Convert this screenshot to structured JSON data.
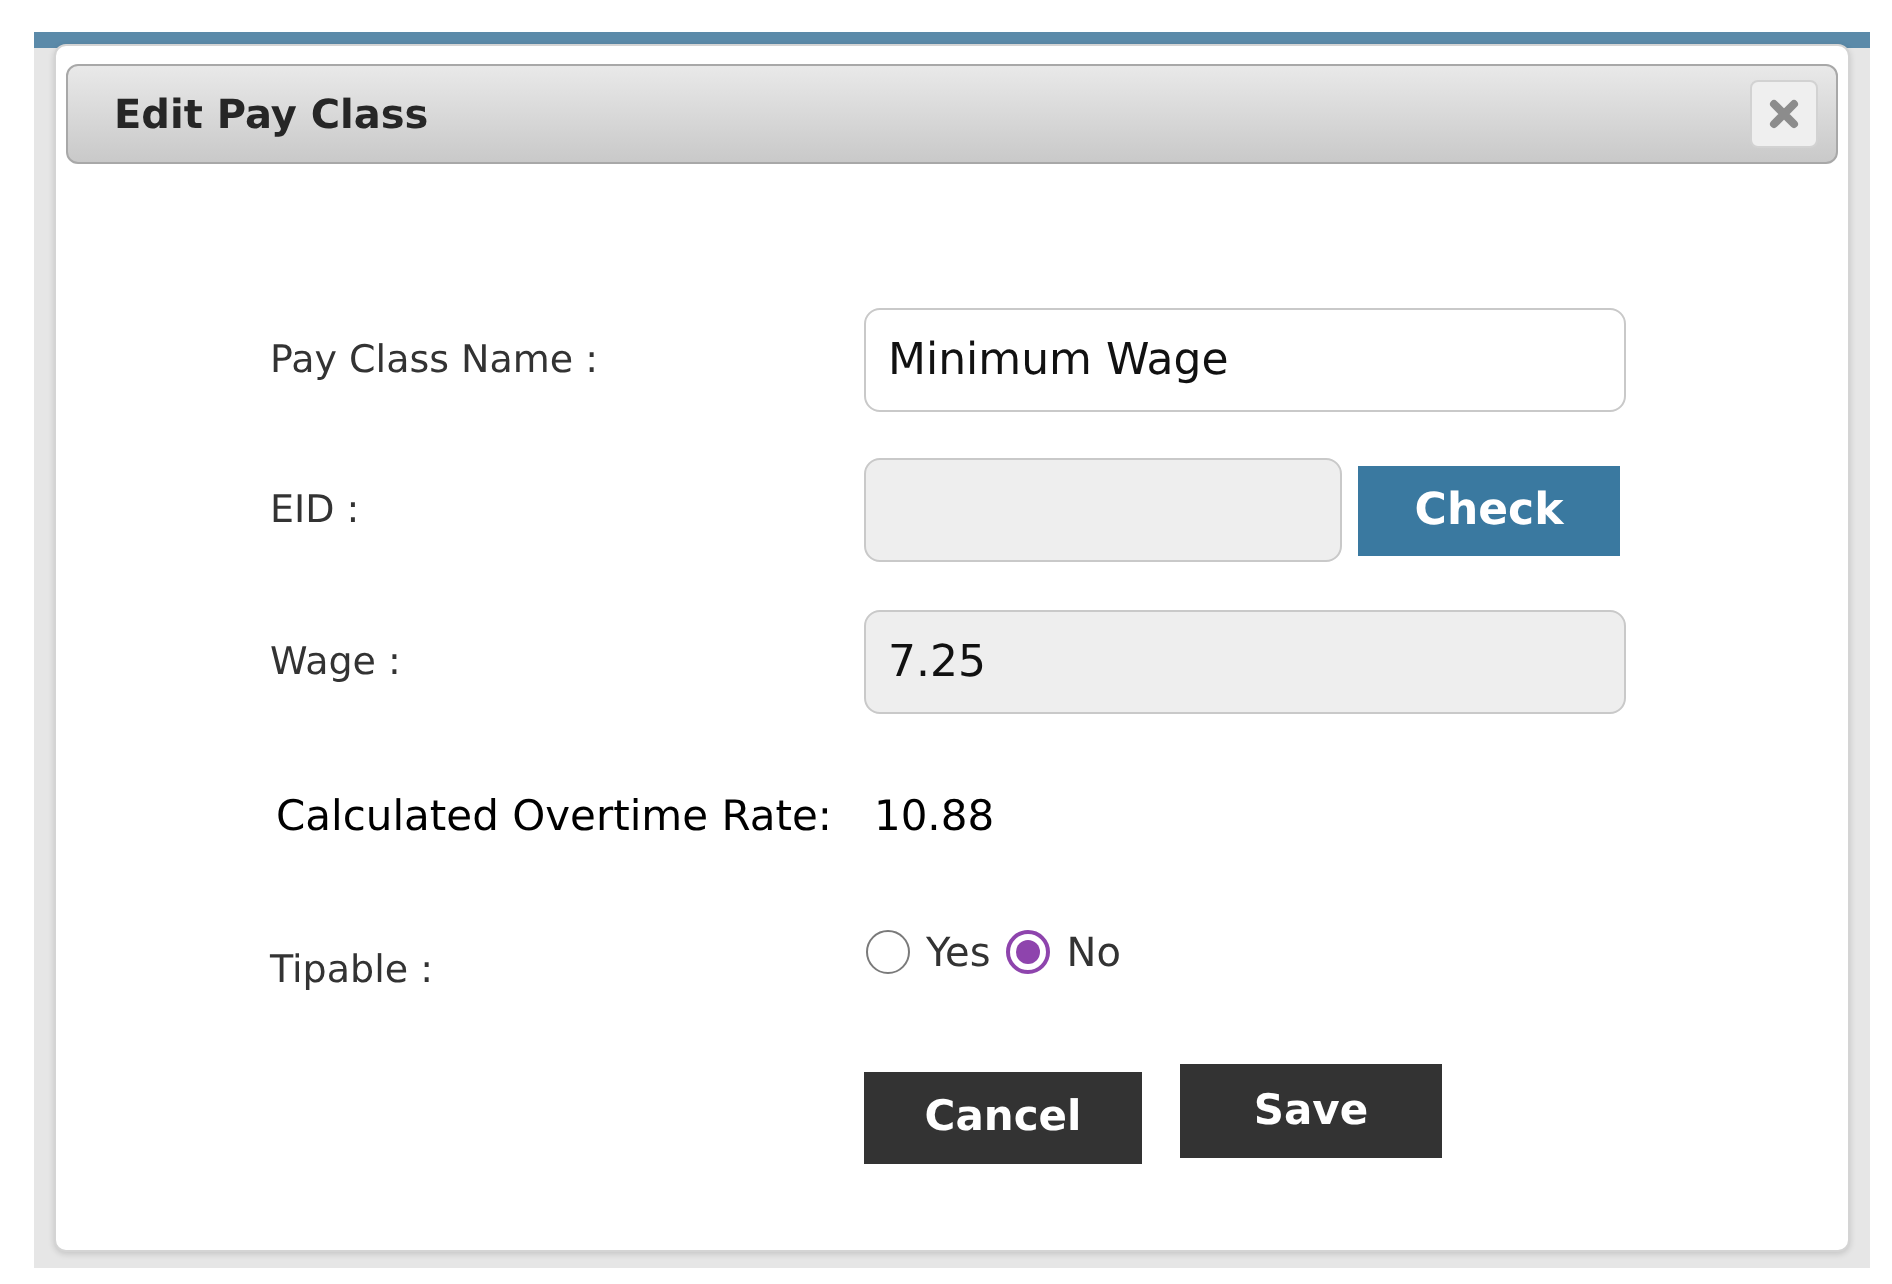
{
  "dialog": {
    "title": "Edit Pay Class"
  },
  "rows": [
    {
      "kind": "input",
      "label": "Pay Class Name :",
      "value": "Minimum Wage",
      "disabled": false
    },
    {
      "kind": "input_button",
      "label": "EID :",
      "disabled": true,
      "button": "Check"
    },
    {
      "kind": "input",
      "label": "Wage :",
      "value": "7.25",
      "disabled": true
    },
    {
      "kind": "readout",
      "label": "Calculated Overtime Rate:",
      "value": "10.88"
    },
    {
      "kind": "radio",
      "label": "Tipable :",
      "options": [
        {
          "label": "Yes",
          "selected": false
        },
        {
          "label": "No",
          "selected": true
        }
      ]
    }
  ],
  "buttons": [
    {
      "label": "Cancel"
    },
    {
      "label": "Save"
    }
  ]
}
